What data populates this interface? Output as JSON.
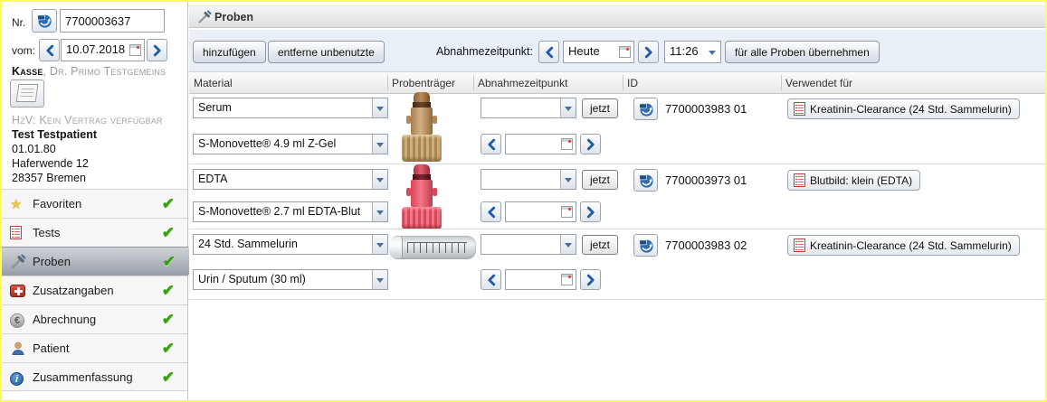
{
  "icons": {
    "check": "✔",
    "star": "★",
    "euro": "€",
    "info_i": "i"
  },
  "order": {
    "nr_label": "Nr.",
    "nr_value": "7700003637",
    "date_label": "vom:",
    "date_value": "10.07.2018",
    "insurer_bold": "Kasse",
    "insurer_rest": ", Dr. Primo Testgemeins",
    "hzv_notice": "HzV: Kein Vertrag verfügbar"
  },
  "patient": {
    "name": "Test Testpatient",
    "birthdate": "01.01.80",
    "street": "Haferwende 12",
    "city": "28357 Bremen"
  },
  "sidebar": {
    "items": [
      {
        "label": "Favoriten",
        "icon": "star-icon",
        "checked": true,
        "selected": false
      },
      {
        "label": "Tests",
        "icon": "tests-document-icon",
        "checked": true,
        "selected": false
      },
      {
        "label": "Proben",
        "icon": "pipette-icon",
        "checked": true,
        "selected": true
      },
      {
        "label": "Zusatzangaben",
        "icon": "first-aid-icon",
        "checked": true,
        "selected": false
      },
      {
        "label": "Abrechnung",
        "icon": "euro-coin-icon",
        "checked": true,
        "selected": false
      },
      {
        "label": "Patient",
        "icon": "person-icon",
        "checked": true,
        "selected": false
      },
      {
        "label": "Zusammenfassung",
        "icon": "info-icon",
        "checked": true,
        "selected": false
      }
    ]
  },
  "panel": {
    "title": "Proben",
    "toolbar": {
      "add": "hinzufügen",
      "remove_unused": "entferne unbenutzte",
      "abnahme_label": "Abnahmezeitpunkt:",
      "date_value": "Heute",
      "time_value": "11:26",
      "apply_all": "für alle Proben übernehmen"
    },
    "table": {
      "headers": [
        "Material",
        "Probenträger",
        "Abnahmezeitpunkt",
        "ID",
        "Verwendet für"
      ],
      "now_label": "jetzt",
      "rows": [
        {
          "material": "Serum",
          "container": "S-Monovette® 4.9 ml Z-Gel",
          "tube": "serum-monovette-brown",
          "sample_id": "7700003983 01",
          "used_for": "Kreatinin-Clearance (24 Std. Sammelurin)"
        },
        {
          "material": "EDTA",
          "container": "S-Monovette® 2.7 ml EDTA-Blut",
          "tube": "edta-monovette-red",
          "sample_id": "7700003973 01",
          "used_for": "Blutbild: klein (EDTA)"
        },
        {
          "material": "24 Std. Sammelurin",
          "container": "Urin / Sputum (30 ml)",
          "tube": "urine-tube-clear",
          "sample_id": "7700003983 02",
          "used_for": "Kreatinin-Clearance (24 Std. Sammelurin)"
        }
      ]
    }
  },
  "colors": {
    "frame_yellow": "#ffff4d",
    "accent_blue": "#1e5ca8",
    "check_green": "#3aa012",
    "selected_item_gray": "#989ea8",
    "toolbar_bg": "#e9eff7",
    "serum_tube": "#c09a6b",
    "edta_tube": "#e85266"
  }
}
